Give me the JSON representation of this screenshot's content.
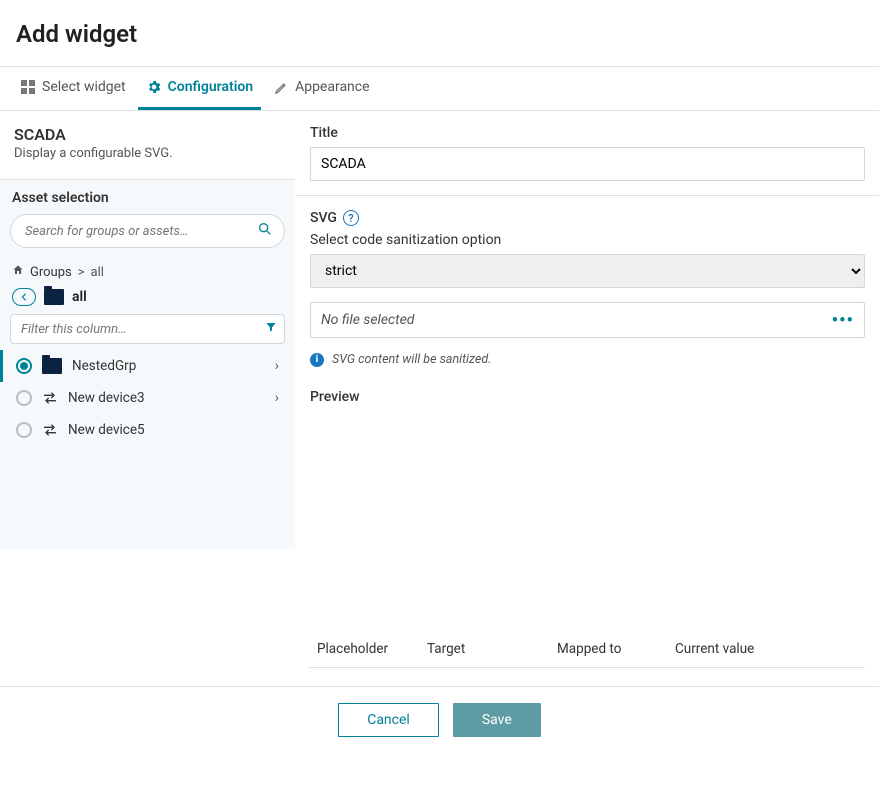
{
  "header": {
    "title": "Add widget"
  },
  "tabs": {
    "select": "Select widget",
    "config": "Configuration",
    "appearance": "Appearance"
  },
  "widget": {
    "name": "SCADA",
    "description": "Display a configurable SVG."
  },
  "asset": {
    "heading": "Asset selection",
    "search_placeholder": "Search for groups or assets…",
    "crumb_root": "Groups",
    "crumb_sep": ">",
    "crumb_leaf": "all",
    "all_label": "all",
    "filter_placeholder": "Filter this column…",
    "items": [
      {
        "label": "NestedGrp",
        "type": "group",
        "selected": true,
        "expandable": true
      },
      {
        "label": "New device3",
        "type": "device",
        "selected": false,
        "expandable": true
      },
      {
        "label": "New device5",
        "type": "device",
        "selected": false,
        "expandable": false
      }
    ]
  },
  "form": {
    "title_label": "Title",
    "title_value": "SCADA",
    "svg_label": "SVG",
    "sanitize_label": "Select code sanitization option",
    "sanitize_value": "strict",
    "file_text": "No file selected",
    "info_text": "SVG content will be sanitized.",
    "preview_label": "Preview"
  },
  "mapping": {
    "cols": [
      "Placeholder",
      "Target",
      "Mapped to",
      "Current value"
    ]
  },
  "footer": {
    "cancel": "Cancel",
    "save": "Save"
  }
}
